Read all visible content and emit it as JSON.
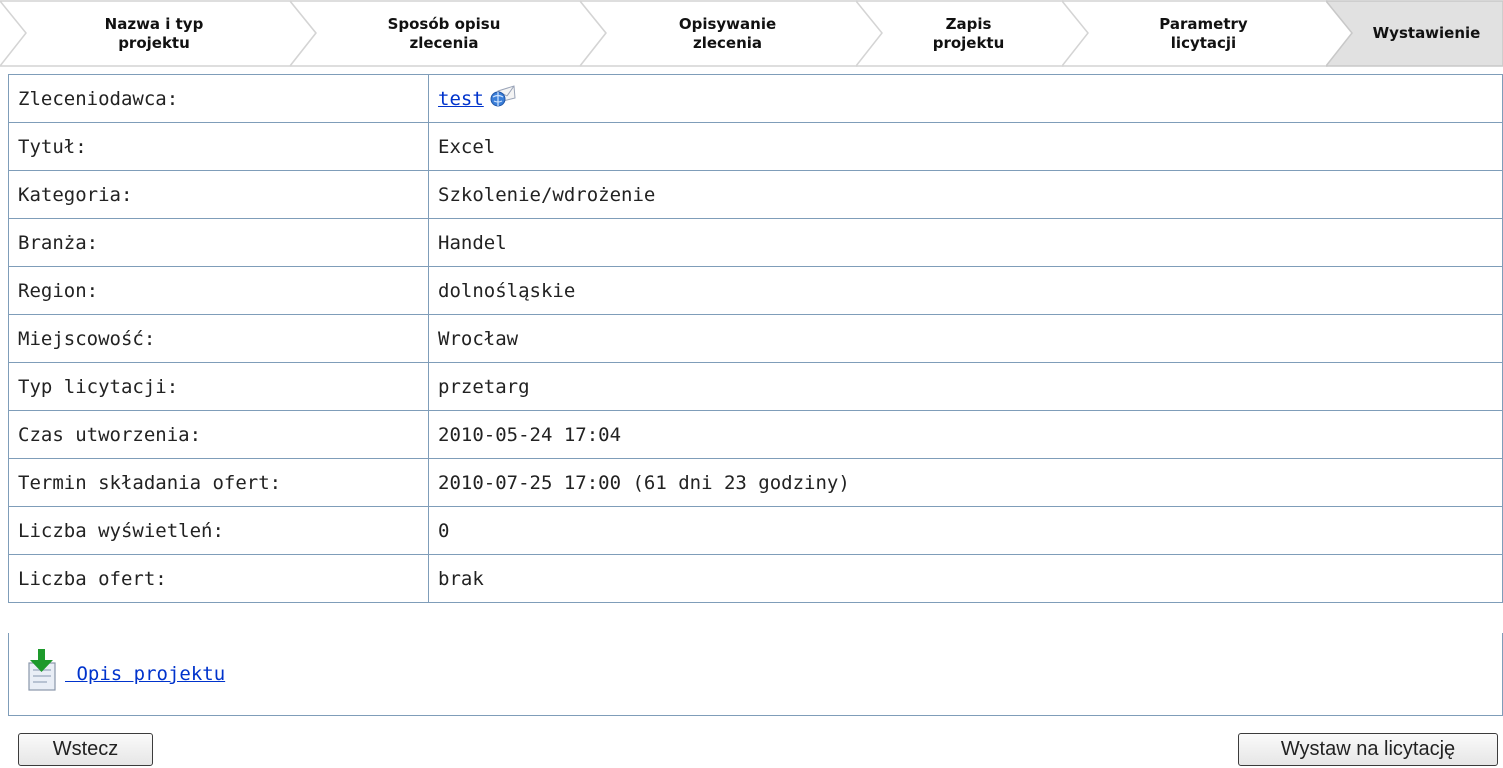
{
  "steps": [
    {
      "label": "Nazwa i typ\nprojektu",
      "active": false
    },
    {
      "label": "Sposób opisu\nzlecenia",
      "active": false
    },
    {
      "label": "Opisywanie\nzlecenia",
      "active": false
    },
    {
      "label": "Zapis\nprojektu",
      "active": false
    },
    {
      "label": "Parametry\nlicytacji",
      "active": false
    },
    {
      "label": "Wystawienie",
      "active": true
    }
  ],
  "details": {
    "client": {
      "label": "Zleceniodawca:",
      "value": "test",
      "icon": "envelope-icon"
    },
    "title": {
      "label": "Tytuł:",
      "value": "Excel"
    },
    "category": {
      "label": "Kategoria:",
      "value": "Szkolenie/wdrożenie"
    },
    "industry": {
      "label": "Branża:",
      "value": "Handel"
    },
    "region": {
      "label": "Region:",
      "value": "dolnośląskie"
    },
    "city": {
      "label": "Miejscowość:",
      "value": "Wrocław"
    },
    "auction_type": {
      "label": "Typ licytacji:",
      "value": "przetarg"
    },
    "created": {
      "label": "Czas utworzenia:",
      "value": "2010-05-24 17:04"
    },
    "deadline": {
      "label": "Termin składania ofert:",
      "value": "2010-07-25 17:00 (61 dni 23 godziny)"
    },
    "views": {
      "label": "Liczba wyświetleń:",
      "value": "0"
    },
    "offers": {
      "label": "Liczba ofert:",
      "value": "brak"
    }
  },
  "description": {
    "link": " Opis projektu",
    "icon": "download-document-icon"
  },
  "buttons": {
    "back": "Wstecz",
    "submit": "Wystaw na licytację"
  },
  "colors": {
    "border": "#7f9db9",
    "link": "#0033cc",
    "active_step": "#e1e1e1",
    "step": "#ffffff"
  }
}
